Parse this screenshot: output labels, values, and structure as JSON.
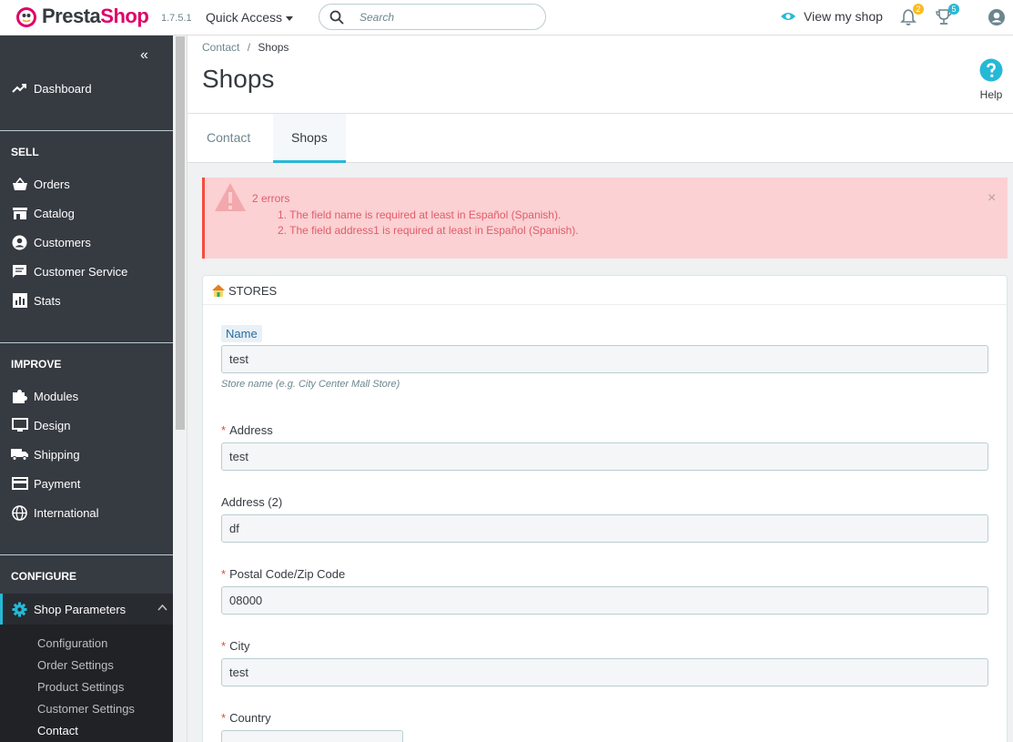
{
  "header": {
    "brand_presta": "Presta",
    "brand_shop": "Shop",
    "version": "1.7.5.1",
    "quick_access": "Quick Access",
    "search_placeholder": "Search",
    "view_shop": "View my shop",
    "notifications_count": "2",
    "trophy_count": "5"
  },
  "sidebar": {
    "dashboard": "Dashboard",
    "sell_title": "SELL",
    "sell_items": [
      "Orders",
      "Catalog",
      "Customers",
      "Customer Service",
      "Stats"
    ],
    "improve_title": "IMPROVE",
    "improve_items": [
      "Modules",
      "Design",
      "Shipping",
      "Payment",
      "International"
    ],
    "configure_title": "CONFIGURE",
    "shop_parameters": "Shop Parameters",
    "sub_items": [
      "Configuration",
      "Order Settings",
      "Product Settings",
      "Customer Settings",
      "Contact"
    ]
  },
  "page": {
    "breadcrumb_parent": "Contact",
    "breadcrumb_sep": "/",
    "breadcrumb_current": "Shops",
    "title": "Shops",
    "help": "Help",
    "tabs": [
      "Contact",
      "Shops"
    ]
  },
  "alert": {
    "title": "2 errors",
    "errors": [
      "1. The field name is required at least in Español (Spanish).",
      "2. The field address1 is required at least in Español (Spanish)."
    ],
    "close": "×"
  },
  "form": {
    "panel_title": "STORES",
    "name_label": "Name",
    "name_value": "test",
    "name_help": "Store name (e.g. City Center Mall Store)",
    "address_label": "Address",
    "address_value": "test",
    "address2_label": "Address (2)",
    "address2_value": "df",
    "postal_label": "Postal Code/Zip Code",
    "postal_value": "08000",
    "city_label": "City",
    "city_value": "test",
    "country_label": "Country",
    "required_mark": "*"
  },
  "colors": {
    "accent": "#25b9d7",
    "sidebar": "#363a41",
    "error_bg": "#fbd1d3",
    "error_text": "#e15c6a"
  }
}
